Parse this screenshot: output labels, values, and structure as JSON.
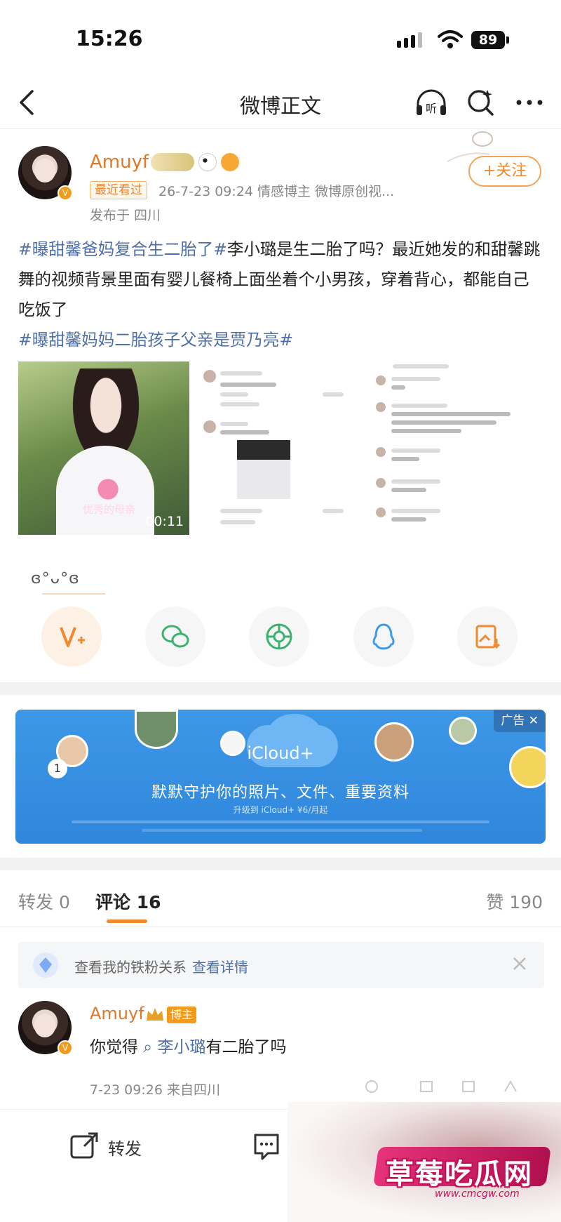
{
  "status_bar": {
    "time": "15:26",
    "battery": "89"
  },
  "nav": {
    "title": "微博正文"
  },
  "post": {
    "author": "Amuyf",
    "recent_tag": "最近看过",
    "meta": "26-7-23 09:24  情感博主  微博原创视...",
    "location": "发布于 四川",
    "follow_label": "+关注",
    "body": {
      "topic1": "#曝甜馨爸妈复合生二胎了#",
      "text1": "李小璐是生二胎了吗？最近她发的和甜馨跳舞的视频背景里面有婴儿餐椅上面坐着个小男孩，穿着背心，都能自己吃饭了",
      "topic2": "#曝甜馨妈妈二胎孩子父亲是贾乃亮#"
    },
    "video": {
      "caption": "优秀的母亲",
      "duration": "00:11"
    },
    "emoticon": "ɞ°ᴗ°ɞ"
  },
  "ad": {
    "label": "广告",
    "brand": "iCloud+",
    "headline": "默默守护你的照片、文件、重要资料",
    "sub": "升级到 iCloud+ ¥6/月起",
    "count": "1"
  },
  "tabs": {
    "repost": "转发 0",
    "comment": "评论 16",
    "likes": "赞 190"
  },
  "fan_card": {
    "text": "查看我的铁粉关系",
    "link": "查看详情"
  },
  "comment": {
    "author": "Amuyf",
    "host_tag": "博主",
    "text_prefix": "你觉得",
    "mention": "李小璐",
    "text_suffix": "有二胎了吗",
    "meta": "7-23 09:26  来自四川"
  },
  "bottom_bar": {
    "repost_label": "转发"
  },
  "watermark": {
    "title": "草莓吃瓜网",
    "url": "www.cmcgw.com"
  },
  "colors": {
    "accent": "#f08a2f",
    "link": "#4e6fa8",
    "ad_bg": "#3d97e6"
  }
}
